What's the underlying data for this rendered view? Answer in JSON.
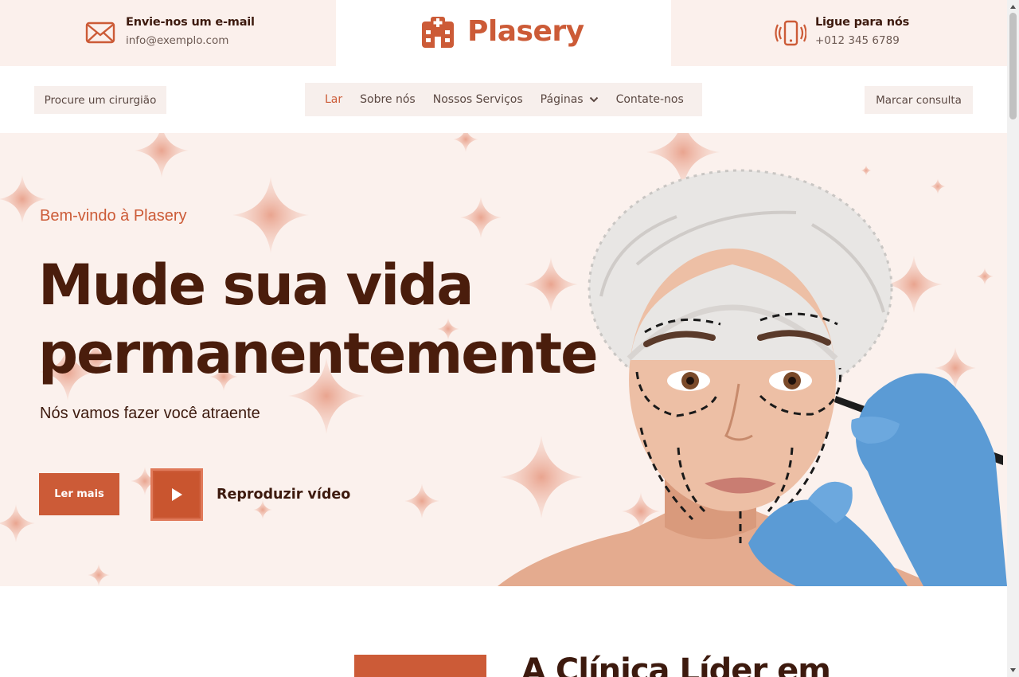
{
  "topbar": {
    "email": {
      "title": "Envie-nos um e-mail",
      "value": "info@exemplo.com",
      "icon": "envelope-icon"
    },
    "phone": {
      "title": "Ligue para nós",
      "value": "+012 345 6789",
      "icon": "vibrating-phone-icon"
    },
    "logo": {
      "text": "Plasery",
      "icon": "hospital-icon"
    }
  },
  "nav": {
    "find_surgeon": "Procure um cirurgião",
    "book": "Marcar consulta",
    "items": [
      {
        "label": "Lar",
        "active": true
      },
      {
        "label": "Sobre nós",
        "active": false
      },
      {
        "label": "Nossos Serviços",
        "active": false
      },
      {
        "label": "Páginas",
        "active": false,
        "icon": "chevron-down-icon"
      },
      {
        "label": "Contate-nos",
        "active": false
      }
    ]
  },
  "hero": {
    "welcome": "Bem-vindo à Plasery",
    "headline_line1": "Mude sua vida",
    "headline_line2": "permanentemente",
    "subline": "Nós vamos fazer você atraente",
    "read_more": "Ler mais",
    "play_video": "Reproduzir vídeo",
    "image": "woman-in-surgical-cap-with-facial-markings"
  },
  "about": {
    "title": "A Clínica Líder em"
  },
  "colors": {
    "accent": "#cc5b37",
    "dark_text": "#4a1d0c",
    "light_bg": "#fbf0ec",
    "glove": "#5b9bd5"
  }
}
